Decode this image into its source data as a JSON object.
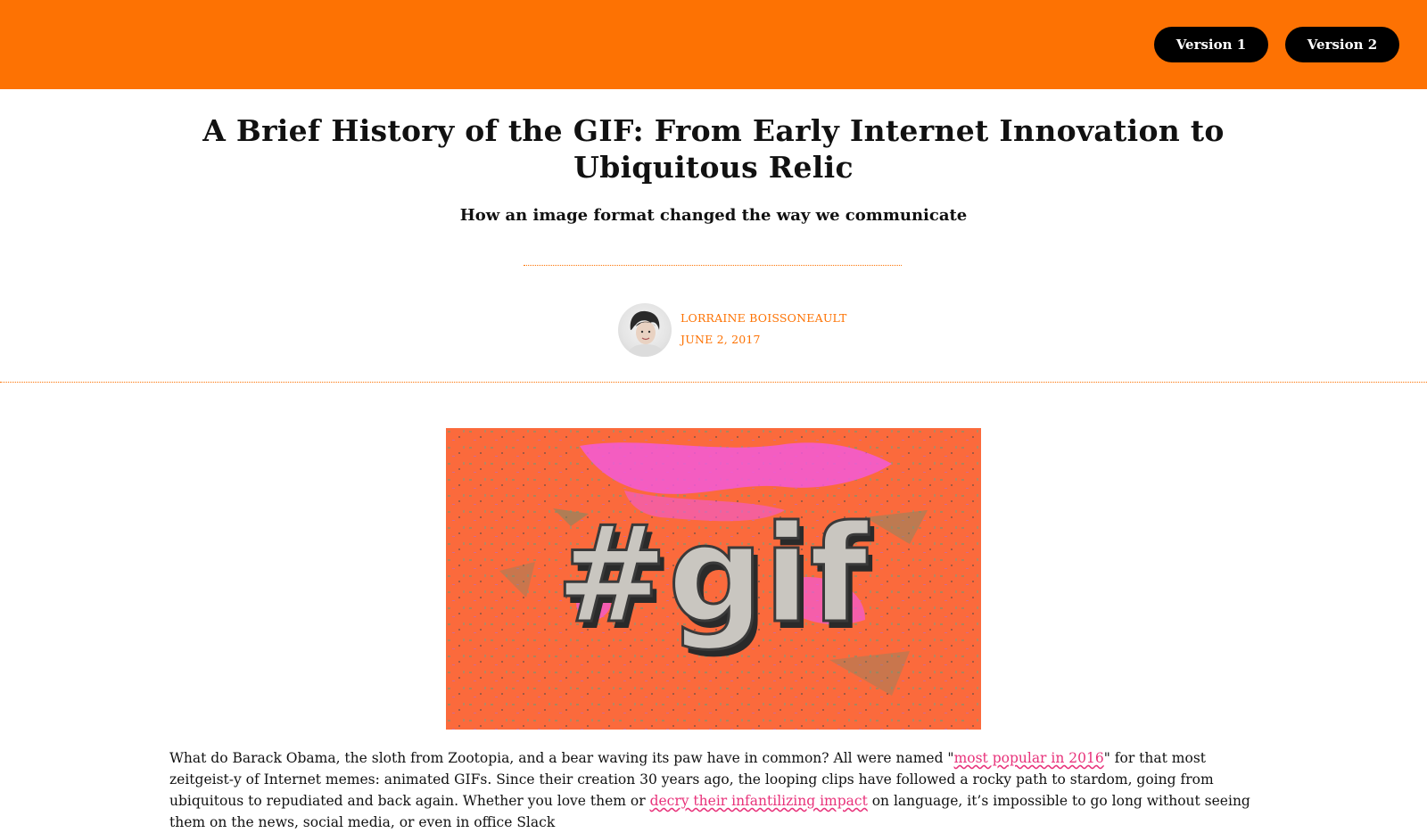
{
  "header": {
    "buttons": [
      "Version 1",
      "Version 2"
    ],
    "background_color": "#fd7203"
  },
  "article": {
    "title": "A Brief History of the GIF: From Early Internet Innovation to Ubiquitous Relic",
    "subtitle": "How an image format changed the way we communicate",
    "author": "LORRAINE BOISSONEAULT",
    "date": "JUNE 2, 2017",
    "hero_image": {
      "text": "#gif"
    },
    "body": {
      "p1_a": "What do Barack Obama, the sloth from Zootopia, and a bear waving its paw have in common? All were named \"",
      "link1": "most popular in 2016",
      "p1_b": "\" for that most zeitgeist-y of Internet memes: animated GIFs. Since their creation 30 years ago, the looping clips have followed a rocky path to stardom, going from ubiquitous to repudiated and back again. Whether you love them or ",
      "link2": "decry their infantilizing impact",
      "p1_c": " on language, it’s impossible to go long without seeing them on the news, social media, or even in office Slack"
    }
  },
  "colors": {
    "accent": "#fd7203",
    "link": "#e8327a",
    "button_bg": "#000000",
    "button_text": "#ffffff"
  }
}
